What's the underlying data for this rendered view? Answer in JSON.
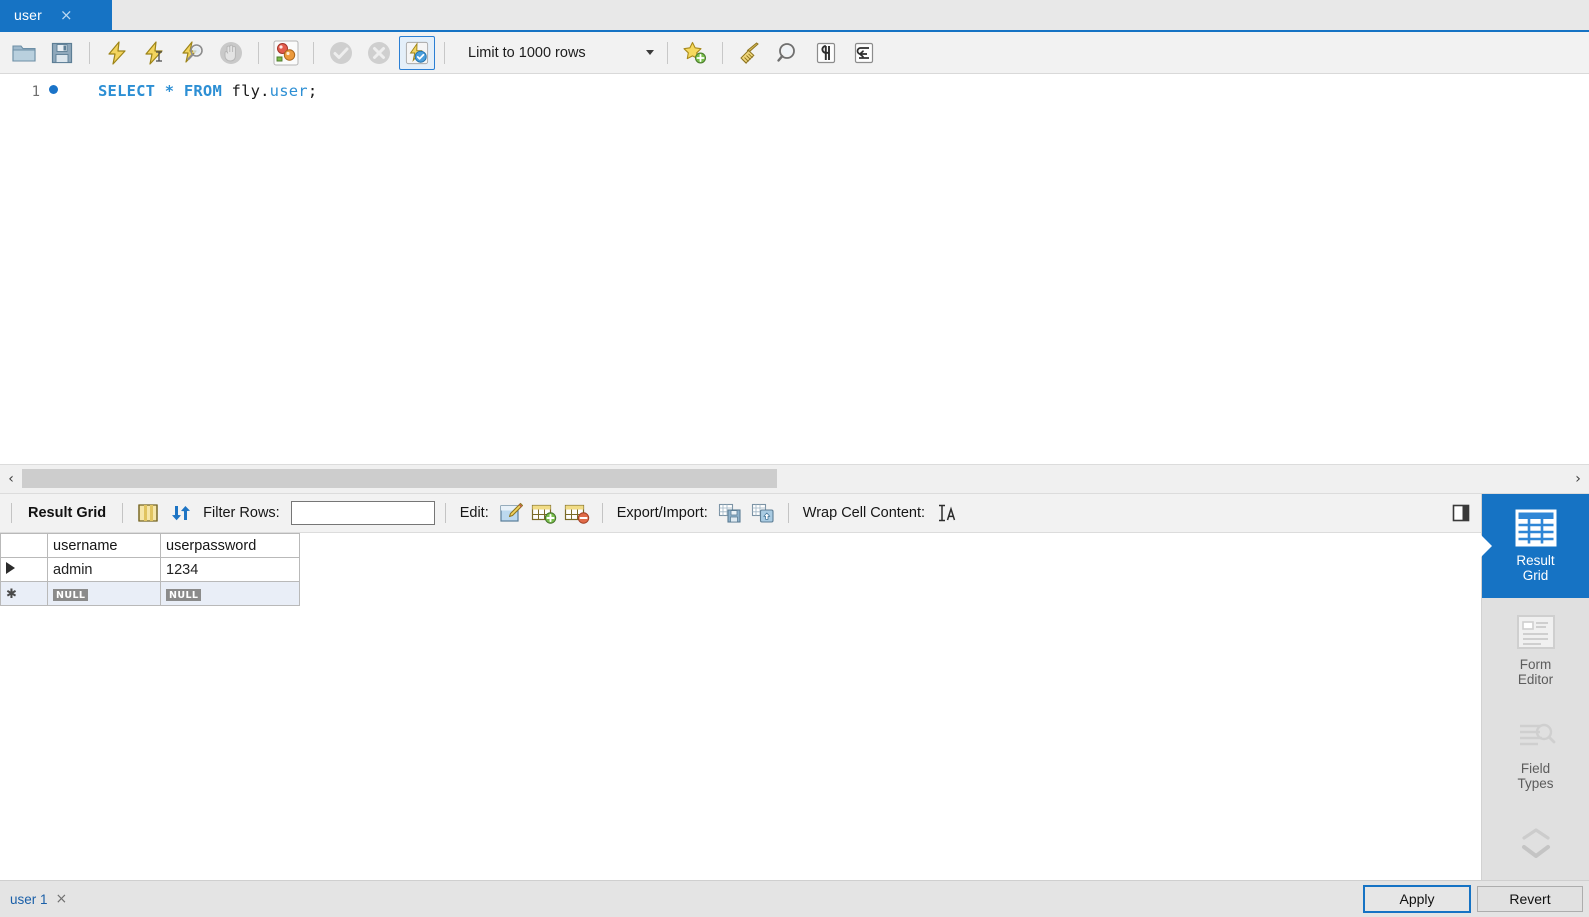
{
  "window": {
    "app": "MySQL Workbench SQL Editor"
  },
  "editor_tabs": [
    {
      "label": "user",
      "close": "×",
      "active": true
    }
  ],
  "sql_toolbar": {
    "buttons": [
      {
        "name": "open-sql-file-button",
        "icon": "folder-icon",
        "title": "Open a script file in this editor",
        "enabled": true,
        "framed": false
      },
      {
        "name": "save-sql-file-button",
        "icon": "save-disk-icon",
        "title": "Save the script to a file",
        "enabled": true,
        "framed": false
      },
      {
        "name": "execute-statement-button",
        "icon": "lightning-icon",
        "title": "Execute the selected portion",
        "enabled": true,
        "framed": false
      },
      {
        "name": "execute-current-statement-button",
        "icon": "lightning-cursor-icon",
        "title": "Execute the statement under the keyboard cursor",
        "enabled": true,
        "framed": false
      },
      {
        "name": "explain-statement-button",
        "icon": "lightning-magnifier-icon",
        "title": "Execute Explain for the current statement",
        "enabled": true,
        "framed": false
      },
      {
        "name": "stop-button",
        "icon": "stop-hand-icon",
        "title": "Stop the query being executed",
        "enabled": false,
        "framed": false
      },
      {
        "name": "toggle-explain-button",
        "icon": "explain-circles-icon",
        "title": "Toggle whether execution of SQL script should continue after failed statements",
        "enabled": true,
        "framed": false
      },
      {
        "name": "commit-button",
        "icon": "commit-check-icon",
        "title": "Commit the current transaction",
        "enabled": false,
        "framed": false
      },
      {
        "name": "rollback-button",
        "icon": "rollback-x-icon",
        "title": "Rollback the current transaction",
        "enabled": false,
        "framed": false
      },
      {
        "name": "autocommit-toggle-button",
        "icon": "autocommit-icon",
        "title": "Toggle autocommit mode",
        "enabled": true,
        "framed": true
      }
    ],
    "limit": {
      "label": "Limit to 1000 rows",
      "caret": "chevron-down-icon"
    },
    "right_buttons": [
      {
        "name": "save-snippet-button",
        "icon": "star-plus-icon",
        "title": "Save current statement or selection to the snippet list"
      },
      {
        "name": "beautify-query-button",
        "icon": "broom-icon",
        "title": "Beautify/reformat the SQL script"
      },
      {
        "name": "find-button",
        "icon": "magnifier-icon",
        "title": "Show the Find panel for the editor"
      },
      {
        "name": "invisible-chars-button",
        "icon": "pilcrow-icon",
        "title": "Toggle invisible characters"
      },
      {
        "name": "wrap-lines-button",
        "icon": "wrap-lines-icon",
        "title": "Toggle wrapping of long lines"
      }
    ]
  },
  "sql_editor": {
    "line_number": "1",
    "breakpoint_marker": "statement-dot",
    "statement_parts": {
      "select": "SELECT",
      "star": "*",
      "from": "FROM",
      "schema": "fly.",
      "table": "user",
      "semicolon": ";"
    },
    "full_text": "SELECT * FROM fly.user;"
  },
  "hscrollbar": {
    "left_arrow": "‹",
    "right_arrow": "›"
  },
  "result_toolbar": {
    "title": "Result Grid",
    "fetch_icon": "grid-columns-icon",
    "refresh_icon": "refresh-arrows-icon",
    "filter_label": "Filter Rows:",
    "filter_value": "",
    "filter_placeholder": "",
    "edit_label": "Edit:",
    "edit_icons": [
      {
        "name": "edit-cell-button",
        "icon": "edit-pencil-icon"
      },
      {
        "name": "insert-row-button",
        "icon": "row-add-icon"
      },
      {
        "name": "delete-row-button",
        "icon": "row-delete-icon"
      }
    ],
    "export_label": "Export/Import:",
    "export_icons": [
      {
        "name": "export-recordset-button",
        "icon": "export-disk-icon"
      },
      {
        "name": "import-recordset-button",
        "icon": "import-up-icon"
      }
    ],
    "wrap_label": "Wrap Cell Content:",
    "wrap_icon": "wrap-cell-icon",
    "panel_toggle_icon": "sidebar-toggle-icon"
  },
  "result_grid": {
    "columns": [
      "username",
      "userpassword"
    ],
    "rows": [
      {
        "marker": "current-row-arrow",
        "cells": [
          "admin",
          "1234"
        ],
        "type": "data"
      },
      {
        "marker": "new-row-star",
        "cells": [
          "NULL",
          "NULL"
        ],
        "type": "placeholder"
      }
    ],
    "null_text": "NULL"
  },
  "right_sidebar": {
    "items": [
      {
        "label": "Result\nGrid",
        "icon": "result-grid-icon",
        "active": true
      },
      {
        "label": "Form\nEditor",
        "icon": "form-editor-icon",
        "active": false
      },
      {
        "label": "Field\nTypes",
        "icon": "field-types-icon",
        "active": false
      }
    ],
    "scroll_up_icon": "chevron-up-icon",
    "scroll_down_icon": "chevron-down-icon"
  },
  "footer": {
    "result_tab_label": "user 1",
    "result_tab_close": "×",
    "apply_label": "Apply",
    "revert_label": "Revert"
  },
  "colors": {
    "accent_blue": "#1673c4",
    "tab_active_bg": "#1673c4",
    "toolbar_bg": "#f2f2f2",
    "sidebar_bg": "#e0e0e0",
    "grid_border": "#b9b9b9",
    "new_row_bg": "#e9eef7",
    "null_badge_bg": "#8b8b8b",
    "sql_keyword": "#2d8fd4"
  }
}
